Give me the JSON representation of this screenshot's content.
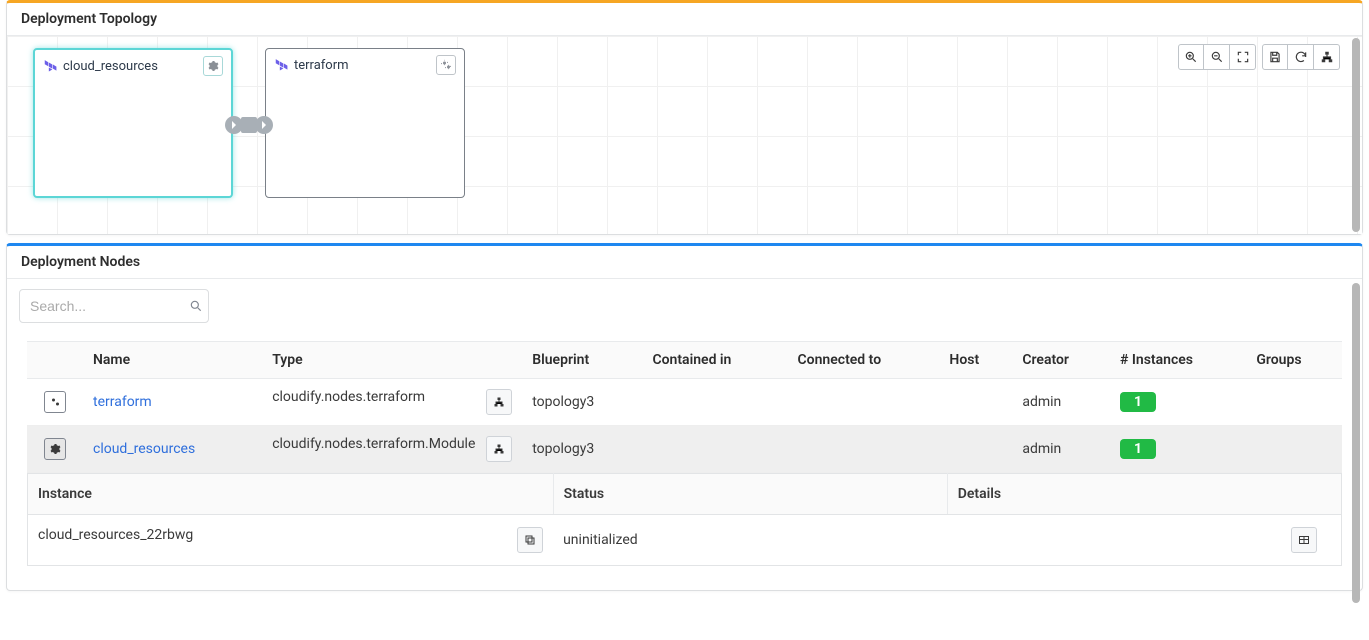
{
  "topology": {
    "title": "Deployment Topology",
    "nodes": [
      {
        "label": "cloud_resources",
        "focused": true
      },
      {
        "label": "terraform",
        "focused": false
      }
    ],
    "toolbar": {
      "zoom_in": "zoom-in",
      "zoom_out": "zoom-out",
      "fit": "fit-to-screen",
      "save": "save",
      "undo": "undo",
      "layout": "auto-layout"
    }
  },
  "nodes_panel": {
    "title": "Deployment Nodes",
    "search_placeholder": "Search...",
    "columns": {
      "name": "Name",
      "type": "Type",
      "blueprint": "Blueprint",
      "contained_in": "Contained in",
      "connected_to": "Connected to",
      "host": "Host",
      "creator": "Creator",
      "instances": "# Instances",
      "groups": "Groups"
    },
    "rows": [
      {
        "name": "terraform",
        "type": "cloudify.nodes.terraform",
        "blueprint": "topology3",
        "contained_in": "",
        "connected_to": "",
        "host": "",
        "creator": "admin",
        "instances": "1",
        "groups": ""
      },
      {
        "name": "cloud_resources",
        "type": "cloudify.nodes.terraform.Module",
        "blueprint": "topology3",
        "contained_in": "",
        "connected_to": "",
        "host": "",
        "creator": "admin",
        "instances": "1",
        "groups": ""
      }
    ],
    "instance_columns": {
      "instance": "Instance",
      "status": "Status",
      "details": "Details"
    },
    "instance_row": {
      "instance": "cloud_resources_22rbwg",
      "status": "uninitialized"
    }
  }
}
